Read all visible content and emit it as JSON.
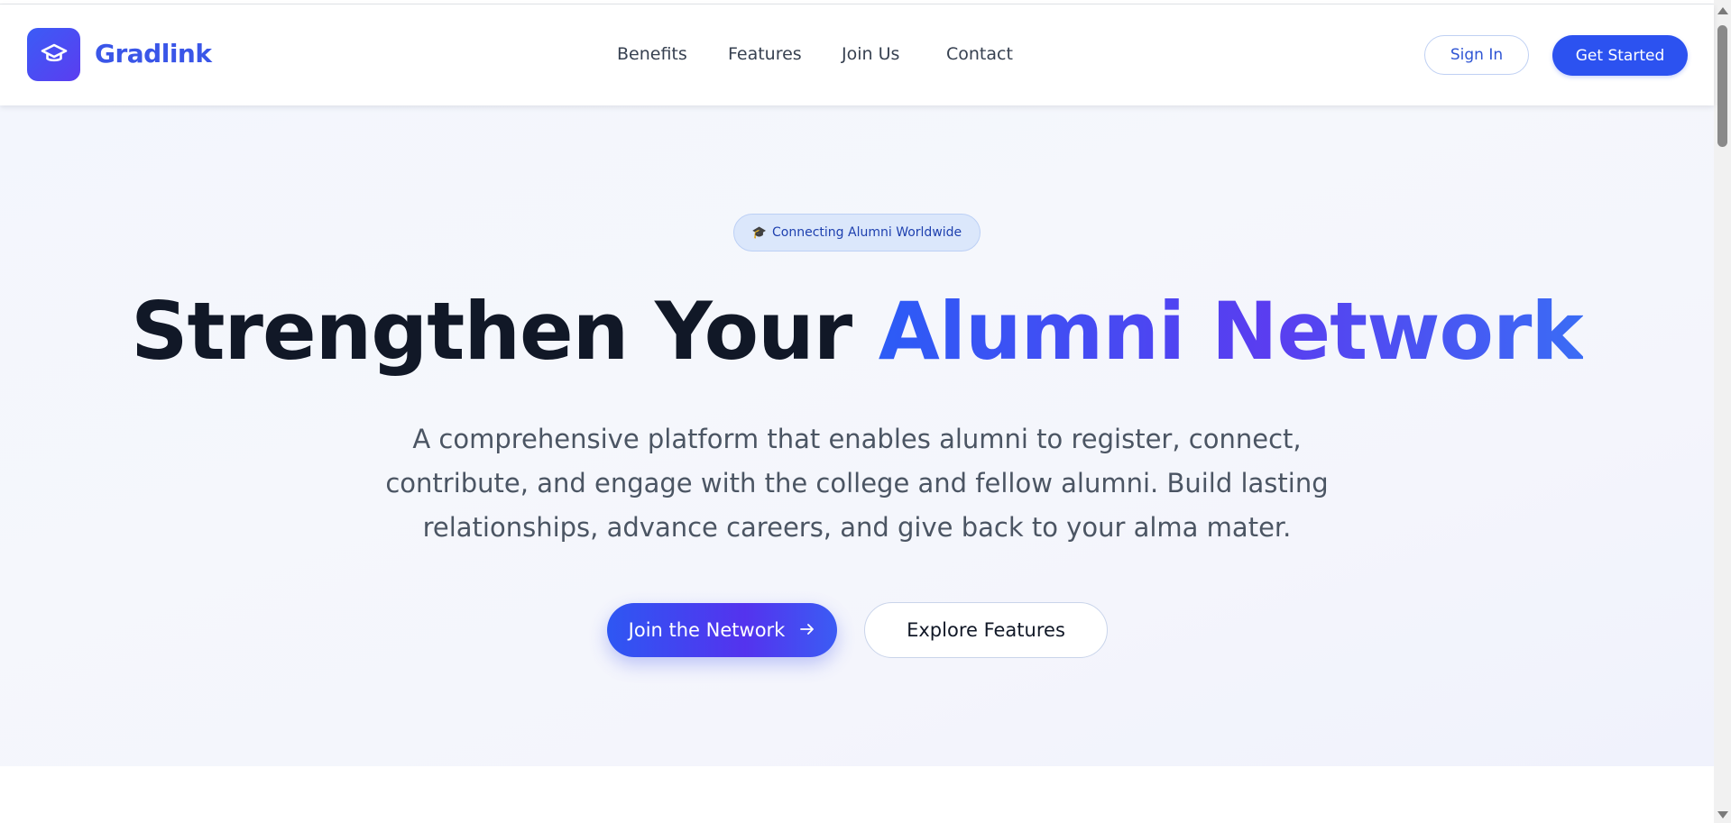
{
  "brand": {
    "name": "Gradlink",
    "logo_icon": "graduation-cap-icon"
  },
  "nav": {
    "links": [
      "Benefits",
      "Features",
      "Join Us",
      "Contact"
    ]
  },
  "auth": {
    "sign_in": "Sign In",
    "get_started": "Get Started"
  },
  "hero": {
    "badge_icon": "🎓",
    "badge_text": "Connecting Alumni Worldwide",
    "headline_plain": "Strengthen Your ",
    "headline_accent": "Alumni Network",
    "subtext": "A comprehensive platform that enables alumni to register, connect, contribute, and engage with the college and fellow alumni. Build lasting relationships, advance careers, and give back to your alma mater.",
    "primary_cta": "Join the Network",
    "primary_cta_icon": "arrow-right-icon",
    "secondary_cta": "Explore Features"
  },
  "colors": {
    "brand_blue": "#2c52f0",
    "accent_purple": "#5a3df0",
    "heading": "#111827"
  }
}
